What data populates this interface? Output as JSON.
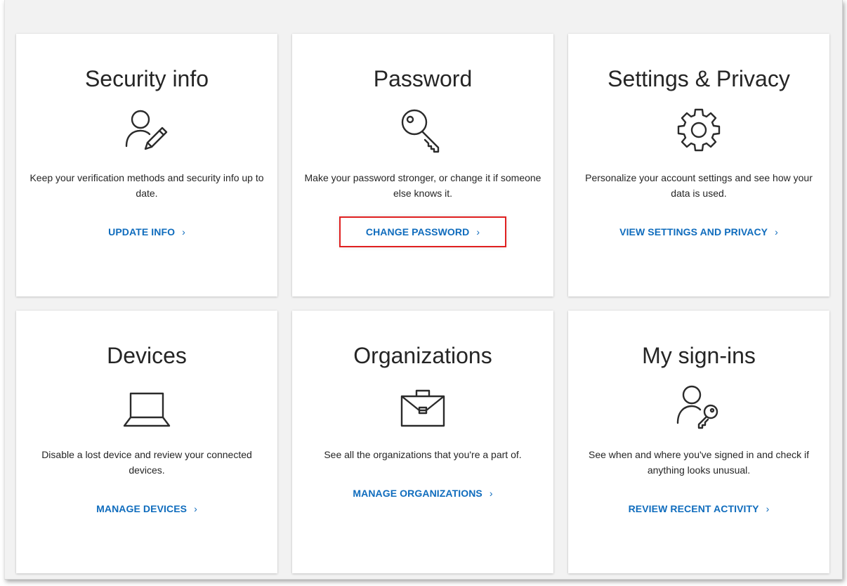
{
  "cards": [
    {
      "title": "Security info",
      "icon": "user-edit-icon",
      "description": "Keep your verification methods and security info up to date.",
      "link": "UPDATE INFO",
      "chevron": "›"
    },
    {
      "title": "Password",
      "icon": "key-icon",
      "description": "Make your password stronger, or change it if someone else knows it.",
      "link": "CHANGE PASSWORD",
      "chevron": "›",
      "highlighted": true
    },
    {
      "title": "Settings & Privacy",
      "icon": "gear-icon",
      "description": "Personalize your account settings and see how your data is used.",
      "link": "VIEW SETTINGS AND PRIVACY",
      "chevron": "›"
    },
    {
      "title": "Devices",
      "icon": "laptop-icon",
      "description": "Disable a lost device and review your connected devices.",
      "link": "MANAGE DEVICES",
      "chevron": "›"
    },
    {
      "title": "Organizations",
      "icon": "briefcase-icon",
      "description": "See all the organizations that you're a part of.",
      "link": "MANAGE ORGANIZATIONS",
      "chevron": "›"
    },
    {
      "title": "My sign-ins",
      "icon": "user-key-icon",
      "description": "See when and where you've signed in and check if anything looks unusual.",
      "link": "REVIEW RECENT ACTIVITY",
      "chevron": "›"
    }
  ],
  "colors": {
    "link": "#0f6cbd",
    "highlight": "#e02020",
    "text": "#252525",
    "background": "#f2f2f2"
  }
}
